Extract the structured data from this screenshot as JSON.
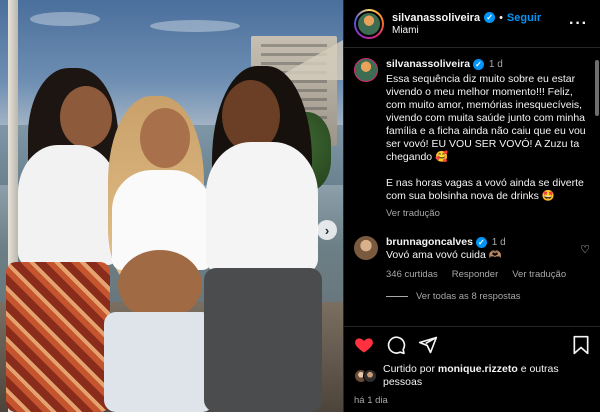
{
  "post": {
    "author": {
      "username": "silvanassoliveira",
      "verified": true,
      "location": "Miami",
      "follow_label": "Seguir"
    },
    "photo": {
      "next_icon": "chevron-right-icon"
    },
    "caption": {
      "username": "silvanassoliveira",
      "time": "1 d",
      "text": "Essa sequência diz muito sobre eu estar vivendo o meu melhor momento!!! Feliz, com muito amor, memórias inesquecíveis, vivendo com muita saúde junto com minha família e a ficha ainda não caiu que eu vou ser vovó! EU VOU SER VOVÓ! A Zuzu ta chegando 🥰\n\nE nas horas vagas a vovó ainda se diverte com sua bolsinha nova de drinks 🤩",
      "see_translation": "Ver tradução"
    },
    "comments": [
      {
        "username": "brunnagoncalves",
        "verified": true,
        "time": "1 d",
        "text": "Vovó ama vovó cuida 🫶🏽",
        "likes_label": "346 curtidas",
        "reply_label": "Responder",
        "translation_label": "Ver tradução",
        "view_replies_label": "Ver todas as 8 respostas"
      }
    ],
    "liked_by": {
      "prefix": "Curtido por ",
      "user": "monique.rizzeto",
      "suffix": " e outras pessoas"
    },
    "time_ago": "há 1 dia"
  },
  "colors": {
    "accent": "#0095f6",
    "like_red": "#ff3040",
    "muted": "#a8a8a8",
    "background": "#000000"
  },
  "icons": {
    "like": "heart-filled-icon",
    "comment": "comment-icon",
    "share": "share-icon",
    "save": "bookmark-icon",
    "more": "more-options-icon"
  }
}
